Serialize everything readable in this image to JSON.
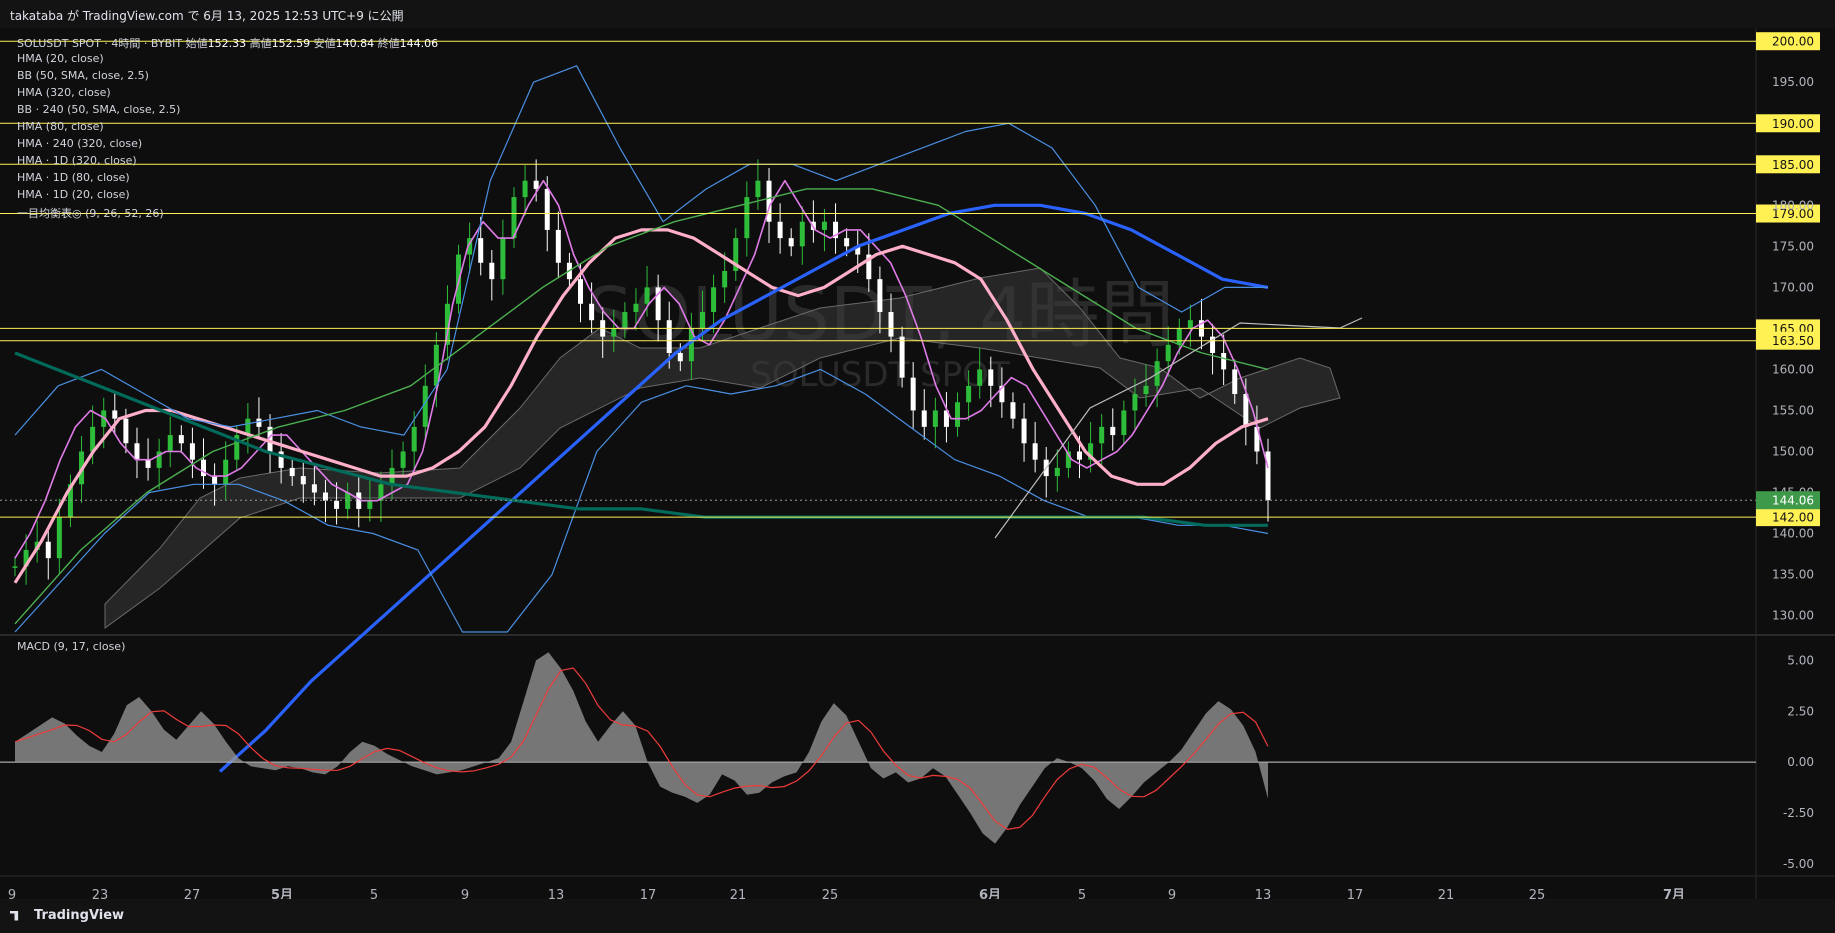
{
  "header": {
    "publish_text": "takataba が TradingView.com で 6月 13, 2025 12:53 UTC+9 に公開"
  },
  "legend": {
    "symbol_line": "SOLUSDT SPOT · 4時間 · BYBIT",
    "ohlc": {
      "o_label": "始値",
      "o": "152.33",
      "h_label": "高値",
      "h": "152.59",
      "l_label": "安値",
      "l": "140.84",
      "c_label": "終値",
      "c": "144.06"
    },
    "indicators": [
      "HMA (20, close)",
      "BB (50, SMA, close, 2.5)",
      "HMA (320, close)",
      "BB · 240 (50, SMA, close, 2.5)",
      "HMA (80, close)",
      "HMA · 240 (320, close)",
      "HMA · 1D (320, close)",
      "HMA · 1D (80, close)",
      "HMA · 1D (20, close)",
      "一目均衡表◎ (9, 26, 52, 26)"
    ]
  },
  "macd_label": "MACD (9, 17, close)",
  "watermark": {
    "big": "SOLUSDT, 4時間",
    "small": "SOLUSDT SPOT"
  },
  "footer": {
    "brand": "TradingView"
  },
  "colors": {
    "bg": "#0e0e0e",
    "up": "#2ebd3a",
    "down": "#ffffff",
    "level": "#fff154",
    "price_tag": "#3e9a4a",
    "hma20": "#e07be8",
    "hma80": "#ffb0c8",
    "hma320": "#2962ff",
    "bb": "#4a90e2",
    "green_ma": "#4caf50",
    "teal_ma": "#006b5b",
    "macd": "#ef3b3b"
  },
  "chart_data": [
    {
      "type": "line",
      "title": "SOLUSDT SPOT · 4時間 · BYBIT",
      "xlabel": "",
      "ylabel": "",
      "ylim": [
        128,
        201
      ],
      "y_ticks": [
        130,
        135,
        140,
        145,
        150,
        155,
        160,
        165,
        170,
        175,
        180,
        185,
        190,
        195,
        200
      ],
      "price_labels": [
        "130.00",
        "135.00",
        "140.00",
        "145.00",
        "150.00",
        "155.00",
        "160.00",
        "165.00",
        "170.00",
        "175.00",
        "180.00",
        "185.00",
        "190.00",
        "195.00",
        "200.00"
      ],
      "x_ticks": [
        {
          "label": "9",
          "bold": false
        },
        {
          "label": "23",
          "bold": false
        },
        {
          "label": "27",
          "bold": false
        },
        {
          "label": "5月",
          "bold": true
        },
        {
          "label": "5",
          "bold": false
        },
        {
          "label": "9",
          "bold": false
        },
        {
          "label": "13",
          "bold": false
        },
        {
          "label": "17",
          "bold": false
        },
        {
          "label": "21",
          "bold": false
        },
        {
          "label": "25",
          "bold": false
        },
        {
          "label": "6月",
          "bold": true
        },
        {
          "label": "5",
          "bold": false
        },
        {
          "label": "9",
          "bold": false
        },
        {
          "label": "13",
          "bold": false
        },
        {
          "label": "17",
          "bold": false
        },
        {
          "label": "21",
          "bold": false
        },
        {
          "label": "25",
          "bold": false
        },
        {
          "label": "7月",
          "bold": true
        }
      ],
      "horizontal_levels": [
        {
          "value": 200,
          "label": "200.00"
        },
        {
          "value": 190,
          "label": "190.00"
        },
        {
          "value": 185,
          "label": "185.00"
        },
        {
          "value": 179,
          "label": "179.00"
        },
        {
          "value": 165,
          "label": "165.00"
        },
        {
          "value": 163.5,
          "label": "163.50"
        },
        {
          "value": 142,
          "label": "142.00"
        }
      ],
      "last_price": {
        "value": 144.06,
        "label": "144.06"
      },
      "close_series": [
        136,
        138,
        139,
        137,
        142,
        146,
        150,
        153,
        155,
        154,
        151,
        149,
        148,
        150,
        152,
        151,
        149,
        147,
        146,
        149,
        152,
        154,
        153,
        150,
        148,
        147,
        146,
        145,
        144,
        143,
        145,
        143,
        144,
        146,
        148,
        150,
        153,
        158,
        163,
        168,
        174,
        176,
        173,
        171,
        176,
        181,
        183,
        182,
        177,
        173,
        171,
        168,
        166,
        164,
        165,
        167,
        168,
        170,
        166,
        162,
        161,
        165,
        167,
        170,
        172,
        176,
        181,
        183,
        178,
        176,
        175,
        178,
        177,
        178,
        176,
        175,
        174,
        171,
        167,
        164,
        159,
        155,
        153,
        155,
        153,
        156,
        158,
        160,
        158,
        156,
        154,
        151,
        149,
        147,
        148,
        150,
        149,
        151,
        153,
        152,
        155,
        157,
        158,
        161,
        163,
        165,
        166,
        164,
        162,
        160,
        157,
        153,
        150,
        144.06
      ],
      "indicator_series": [
        {
          "name": "HMA (20, close)",
          "values": [
            137,
            140,
            144,
            149,
            153,
            155,
            154,
            151,
            149,
            149,
            150,
            150,
            148,
            147,
            147,
            148,
            150,
            152,
            152,
            150,
            148,
            146,
            145,
            144,
            144,
            145,
            146,
            150,
            158,
            168,
            175,
            178,
            176,
            176,
            180,
            183,
            180,
            174,
            170,
            167,
            165,
            165,
            168,
            170,
            168,
            164,
            163,
            166,
            170,
            174,
            180,
            183,
            180,
            177,
            176,
            177,
            177,
            175,
            173,
            169,
            164,
            158,
            154,
            154,
            155,
            157,
            159,
            158,
            155,
            152,
            149,
            148,
            149,
            150,
            152,
            155,
            158,
            162,
            165,
            166,
            164,
            160,
            155,
            148
          ]
        },
        {
          "name": "HMA (80, close)",
          "values": [
            134,
            139,
            145,
            150,
            154,
            155,
            155,
            154,
            153,
            152,
            151,
            150,
            149,
            148,
            147,
            147,
            148,
            150,
            153,
            158,
            164,
            169,
            173,
            176,
            177,
            177,
            176,
            174,
            172,
            170,
            169,
            170,
            172,
            174,
            175,
            174,
            173,
            171,
            166,
            160,
            155,
            150,
            147,
            146,
            146,
            148,
            151,
            153,
            154
          ]
        },
        {
          "name": "HMA (320, close)",
          "values": [
            111,
            116,
            122,
            127,
            132,
            137,
            142,
            147,
            152,
            157,
            162,
            166,
            169,
            172,
            175,
            177,
            179,
            180,
            180,
            179,
            177,
            174,
            171,
            170
          ]
        },
        {
          "name": "BB upper",
          "values": [
            152,
            158,
            160,
            157,
            154,
            153,
            154,
            155,
            153,
            152,
            160,
            183,
            195,
            197,
            187,
            178,
            182,
            185,
            185,
            183,
            185,
            187,
            189,
            190,
            187,
            180,
            170,
            167,
            170,
            170
          ]
        },
        {
          "name": "BB lower",
          "values": [
            128,
            134,
            140,
            145,
            146,
            146,
            144,
            141,
            140,
            138,
            128,
            128,
            135,
            150,
            156,
            158,
            157,
            158,
            160,
            157,
            153,
            149,
            147,
            144,
            142,
            142,
            141,
            141,
            140
          ]
        },
        {
          "name": "HMA · 240 (320, close)",
          "values": [
            129,
            138,
            145,
            150,
            153,
            155,
            158,
            164,
            170,
            175,
            178,
            180,
            182,
            182,
            180,
            175,
            170,
            165,
            162,
            160
          ]
        },
        {
          "name": "HMA · 1D (320, close)",
          "values": [
            162,
            159,
            156,
            153,
            150,
            148,
            146,
            145,
            144,
            143,
            143,
            142,
            142,
            142,
            142,
            142,
            142,
            142,
            142,
            141,
            141
          ]
        }
      ]
    },
    {
      "type": "area",
      "title": "MACD (9, 17, close)",
      "ylim": [
        -5,
        6
      ],
      "y_ticks": [
        -5,
        -2.5,
        0,
        2.5,
        5
      ],
      "price_labels": [
        "-5.00",
        "-2.50",
        "0.00",
        "2.50",
        "5.00"
      ],
      "series": [
        {
          "name": "",
          "values": [
            1.0,
            1.4,
            1.8,
            2.2,
            1.9,
            1.3,
            0.8,
            0.5,
            1.4,
            2.8,
            3.2,
            2.5,
            1.6,
            1.1,
            1.8,
            2.5,
            1.9,
            1.0,
            0.2,
            -0.2,
            -0.3,
            -0.4,
            -0.2,
            -0.3,
            -0.5,
            -0.6,
            -0.2,
            0.5,
            1.0,
            0.8,
            0.4,
            0.1,
            -0.2,
            -0.4,
            -0.6,
            -0.5,
            -0.4,
            -0.2,
            0.0,
            0.2,
            1.0,
            3.0,
            5.0,
            5.4,
            4.6,
            3.5,
            2.0,
            1.0,
            1.8,
            2.5,
            1.8,
            0.0,
            -1.2,
            -1.5,
            -1.7,
            -2.0,
            -1.6,
            -0.6,
            -0.9,
            -1.6,
            -1.5,
            -1.0,
            -0.7,
            -0.5,
            0.5,
            2.0,
            2.9,
            2.3,
            1.0,
            -0.3,
            -0.8,
            -0.5,
            -1.0,
            -0.8,
            -0.3,
            -0.7,
            -1.6,
            -2.5,
            -3.5,
            -4.0,
            -3.2,
            -2.1,
            -1.2,
            -0.3,
            0.2,
            0.0,
            -0.3,
            -0.9,
            -1.8,
            -2.3,
            -1.7,
            -1.0,
            -0.5,
            0.0,
            0.6,
            1.5,
            2.4,
            3.0,
            2.6,
            1.8,
            0.5,
            -1.8
          ]
        }
      ]
    }
  ]
}
